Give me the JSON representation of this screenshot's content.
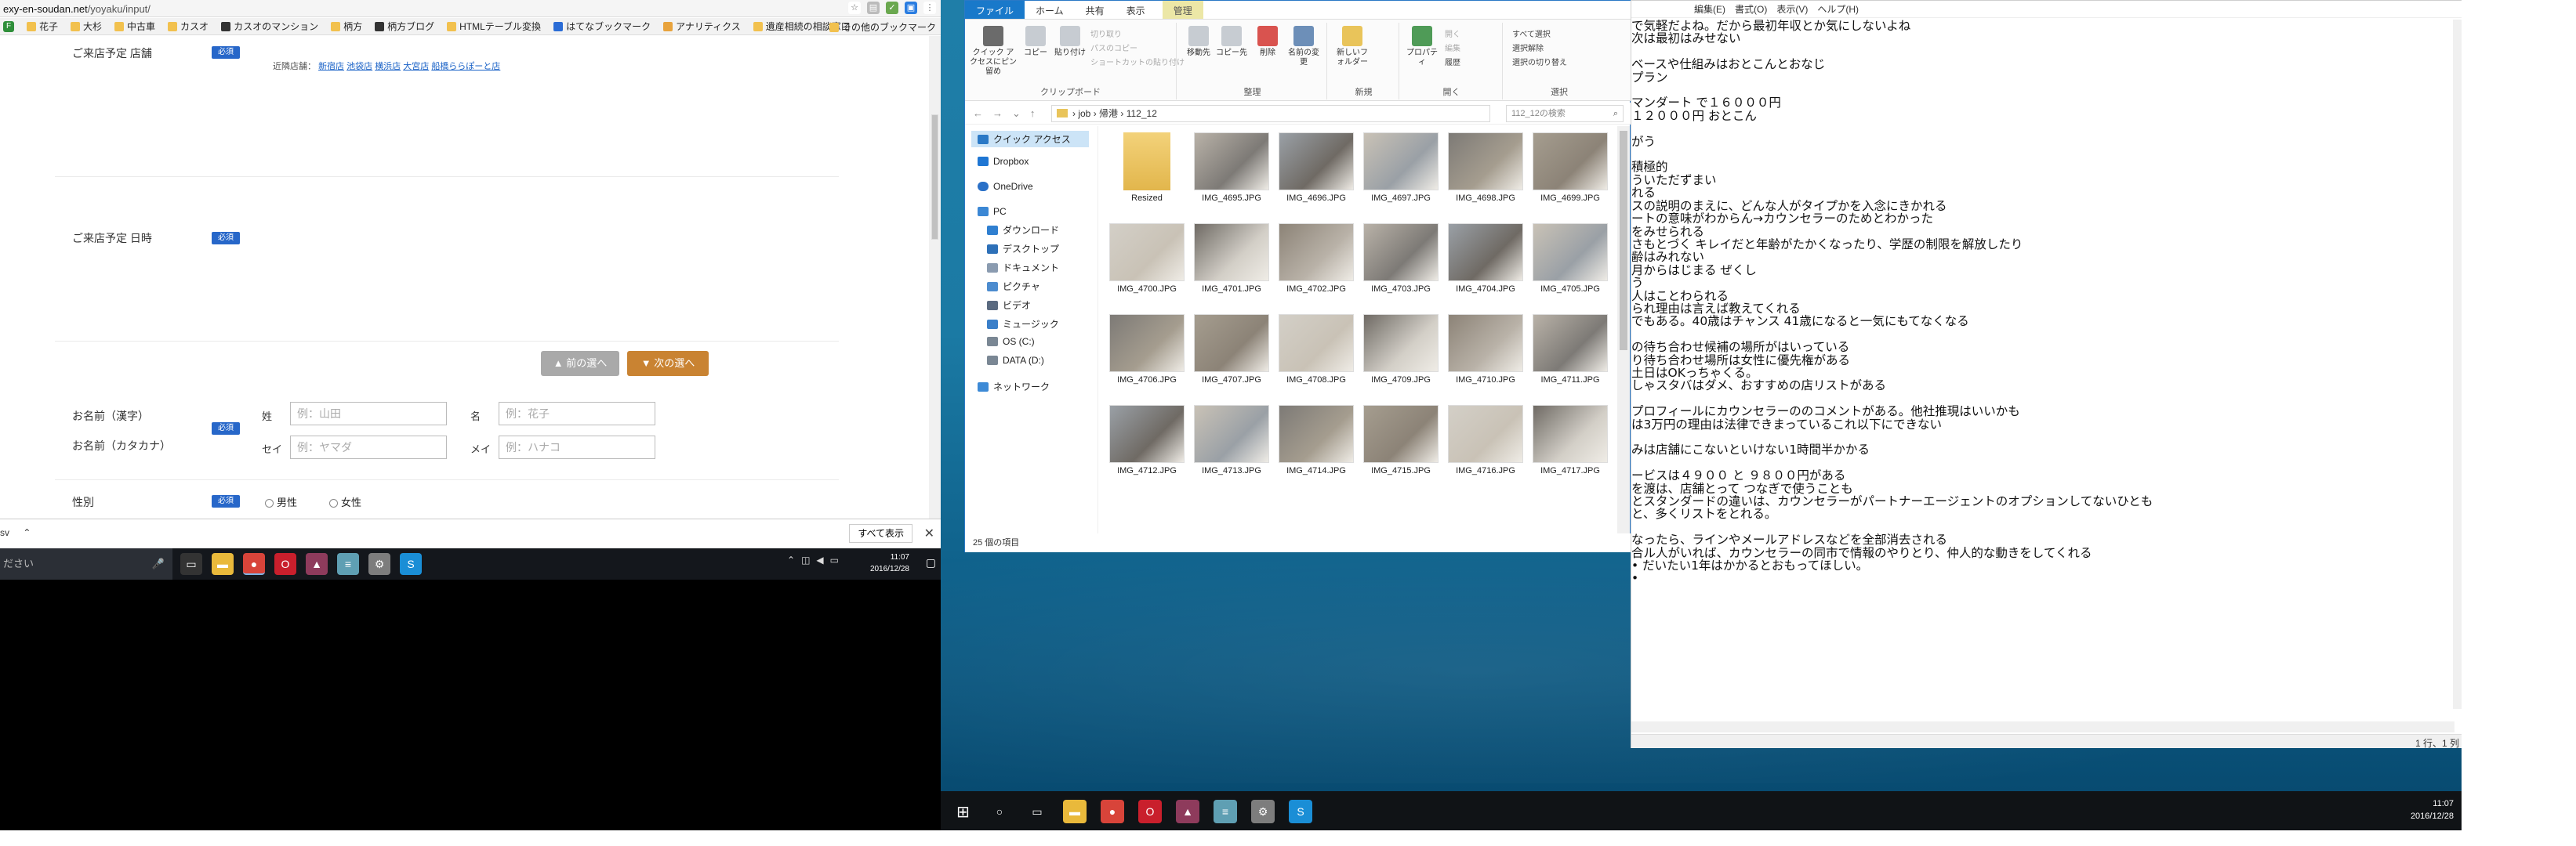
{
  "browser": {
    "url_prefix": "exy-en-soudan.net",
    "url_path": "/yoyaku/input/",
    "bookmarks": [
      "花子",
      "大杉",
      "中古車",
      "カスオ",
      "カスオのマンション",
      "柄方",
      "柄方ブログ",
      "HTMLテーブル変換",
      "はてなブックマーク",
      "アナリティクス",
      "遺産相続の相談窓口"
    ],
    "bookmarks_other": "その他のブックマーク"
  },
  "form": {
    "store_label": "ご来店予定 店舗",
    "nearby_label": "近隣店舗：",
    "nearby_stores": [
      "新宿店",
      "池袋店",
      "横浜店",
      "大宮店",
      "船橋ららぽーと店"
    ],
    "date_label": "ご来店予定 日時",
    "required": "必須",
    "prev_button": "▲ 前の選へ",
    "next_button": "▼ 次の選へ",
    "name_kanji_label": "お名前（漢字）",
    "name_kana_label": "お名前（カタカナ）",
    "sei_kanji": "姓",
    "mei_kanji": "名",
    "sei_kana": "セイ",
    "mei_kana": "メイ",
    "ph_sei_kanji": "例：山田",
    "ph_mei_kanji": "例：花子",
    "ph_sei_kana": "例：ヤマダ",
    "ph_mei_kana": "例：ハナコ",
    "gender_label": "性別",
    "male": "男性",
    "female": "女性"
  },
  "downloads": {
    "file": "sv",
    "show_all": "すべて表示"
  },
  "taskbar_left": {
    "search_placeholder": "ださい",
    "time": "11:07",
    "date": "2016/12/28"
  },
  "explorer": {
    "tabs": [
      "ファイル",
      "ホーム",
      "共有",
      "表示"
    ],
    "context_tab": "管理",
    "ribbon": {
      "quick_access": "クイック アクセスにピン留め",
      "copy": "コピー",
      "paste": "貼り付け",
      "cut": "切り取り",
      "copy_path": "パスのコピー",
      "paste_shortcut": "ショートカットの貼り付け",
      "clipboard": "クリップボード",
      "move_to": "移動先",
      "copy_to": "コピー先",
      "delete": "削除",
      "rename": "名前の変更",
      "organize": "整理",
      "new_folder": "新しいフォルダー",
      "new": "新規",
      "properties": "プロパティ",
      "open": "開く",
      "edit": "編集",
      "history": "履歴",
      "open_group": "開く",
      "select_all": "すべて選択",
      "select_none": "選択解除",
      "invert": "選択の切り替え",
      "select": "選択"
    },
    "path": [
      "job",
      "帰港",
      "112_12"
    ],
    "search_placeholder": "112_12の検索",
    "nav": {
      "quick_access": "クイック アクセス",
      "dropbox": "Dropbox",
      "onedrive": "OneDrive",
      "pc": "PC",
      "downloads": "ダウンロード",
      "desktop": "デスクトップ",
      "documents": "ドキュメント",
      "pictures": "ピクチャ",
      "videos": "ビデオ",
      "music": "ミュージック",
      "os": "OS (C:)",
      "data": "DATA (D:)",
      "network": "ネットワーク"
    },
    "files": [
      "Resized",
      "IMG_4695.JPG",
      "IMG_4696.JPG",
      "IMG_4697.JPG",
      "IMG_4698.JPG",
      "IMG_4699.JPG",
      "IMG_4700.JPG",
      "IMG_4701.JPG",
      "IMG_4702.JPG",
      "IMG_4703.JPG",
      "IMG_4704.JPG",
      "IMG_4705.JPG",
      "IMG_4706.JPG",
      "IMG_4707.JPG",
      "IMG_4708.JPG",
      "IMG_4709.JPG",
      "IMG_4710.JPG",
      "IMG_4711.JPG",
      "IMG_4712.JPG",
      "IMG_4713.JPG",
      "IMG_4714.JPG",
      "IMG_4715.JPG",
      "IMG_4716.JPG",
      "IMG_4717.JPG"
    ],
    "status": "25 個の項目"
  },
  "notepad": {
    "menu": [
      "編集(E)",
      "書式(O)",
      "表示(V)",
      "ヘルプ(H)"
    ],
    "text": "で気軽だよね。だから最初年収とか気にしないよね\n次は最初はみせない\n\nベースや仕組みはおとこんとおなじ\nプラン\n\nマンダート で１６０００円\n１２０００円 おとこん\n\nがう\n\n積極的\nういただずまい\nれる\nスの説明のまえに、どんな人がタイプかを入念にきかれる\nートの意味がわからん→カウンセラーのためとわかった\nをみせられる\nさもとづく キレイだと年齢がたかくなったり、学歴の制限を解放したり\n齢はみれない\n月からはじまる ぜくし\nう\n人はことわられる\nられ理由は言えば教えてくれる\nでもある。40歳はチャンス 41歳になると一気にもてなくなる\n\nの待ち合わせ候補の場所がはいっている\nり待ち合わせ場所は女性に優先権がある\n土日はOKっちゃくる。\nしゃスタバはダメ、おすすめの店リストがある\n\nプロフィールにカウンセラーののコメントがある。他社推現はいいかも\nは3万円の理由は法律できまっているこれ以下にできない\n\nみは店舗にこないといけない1時間半かかる\n\nービスは４９００ と ９８００円がある\nを渡は、店舗とって つなぎで使うことも\nとスタンダードの違いは、カウンセラーがパートナーエージェントのオプションしてないひとも\nと、多くリストをとれる。\n\nなったら、ラインやメールアドレスなどを全部消去される\n合ル人がいれば、カウンセラーの同市で情報のやりとり、仲人的な動きをしてくれる\n• だいたい1年はかかるとおもってほしい。\n•",
    "status": "1 行、1 列"
  },
  "taskbar_right": {
    "time": "11:07",
    "date": "2016/12/28"
  }
}
